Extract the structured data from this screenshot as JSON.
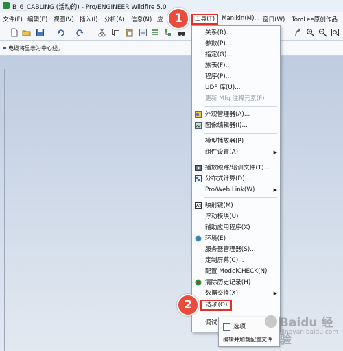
{
  "window": {
    "title": "B_6_CABLING (活动的) - Pro/ENGINEER Wildfire 5.0"
  },
  "menubar": {
    "items": [
      {
        "label": "文件(F)"
      },
      {
        "label": "编辑(E)"
      },
      {
        "label": "视图(V)"
      },
      {
        "label": "插入(I)"
      },
      {
        "label": "分析(A)"
      },
      {
        "label": "信息(N)"
      },
      {
        "label": "应"
      },
      {
        "label": "工具(T)"
      },
      {
        "label": "Manikin(M)..."
      },
      {
        "label": "窗口(W)"
      },
      {
        "label": "TomLee原创作品"
      }
    ]
  },
  "toolbar": {
    "icons": [
      "new-icon",
      "open-icon",
      "save-icon",
      "undo-icon",
      "redo-icon",
      "cut-icon",
      "copy-icon",
      "paste-icon",
      "regen-icon",
      "find-icon",
      "rotate-icon",
      "zoom-in-icon",
      "zoom-out-icon",
      "refit-icon"
    ]
  },
  "status": {
    "message": "电缆将显示为中心线。"
  },
  "tools_menu": {
    "items": [
      {
        "label": "关系(R)..."
      },
      {
        "label": "参数(P)..."
      },
      {
        "label": "指定(G)..."
      },
      {
        "label": "族表(F)..."
      },
      {
        "label": "程序(P)..."
      },
      {
        "label": "UDF 库(U)..."
      },
      {
        "label": "更新 Mfg 注释元素(F)"
      },
      {
        "label": "外观管理器(A)..."
      },
      {
        "label": "图像编辑器(I)..."
      },
      {
        "label": "模型播放器(P)"
      },
      {
        "label": "组件设置(A)"
      },
      {
        "label": "播放跟踪/培训文件(T)..."
      },
      {
        "label": "分布式计算(D)..."
      },
      {
        "label": "Pro/Web.Link(W)"
      },
      {
        "label": "映射键(M)"
      },
      {
        "label": "浮动模块(U)"
      },
      {
        "label": "辅助应用程序(X)"
      },
      {
        "label": "环境(E)"
      },
      {
        "label": "服务器管理器(S)..."
      },
      {
        "label": "定制屏幕(C)..."
      },
      {
        "label": "配置 ModelCHECK(N)"
      },
      {
        "label": "清除历史记录(H)"
      },
      {
        "label": "数据交换(X)"
      },
      {
        "label": "选项(O)"
      },
      {
        "label": "调试"
      }
    ]
  },
  "tooltip": {
    "title": "选项",
    "description": "编辑并加载配置文件"
  },
  "callouts": [
    {
      "number": "1"
    },
    {
      "number": "2"
    }
  ],
  "watermark": {
    "text": "Baidu 经验",
    "url": "jingyan.baidu.com"
  },
  "colors": {
    "callout": "#e94b3c",
    "highlight_border": "#e23227",
    "canvas": "#c9d4e6"
  }
}
